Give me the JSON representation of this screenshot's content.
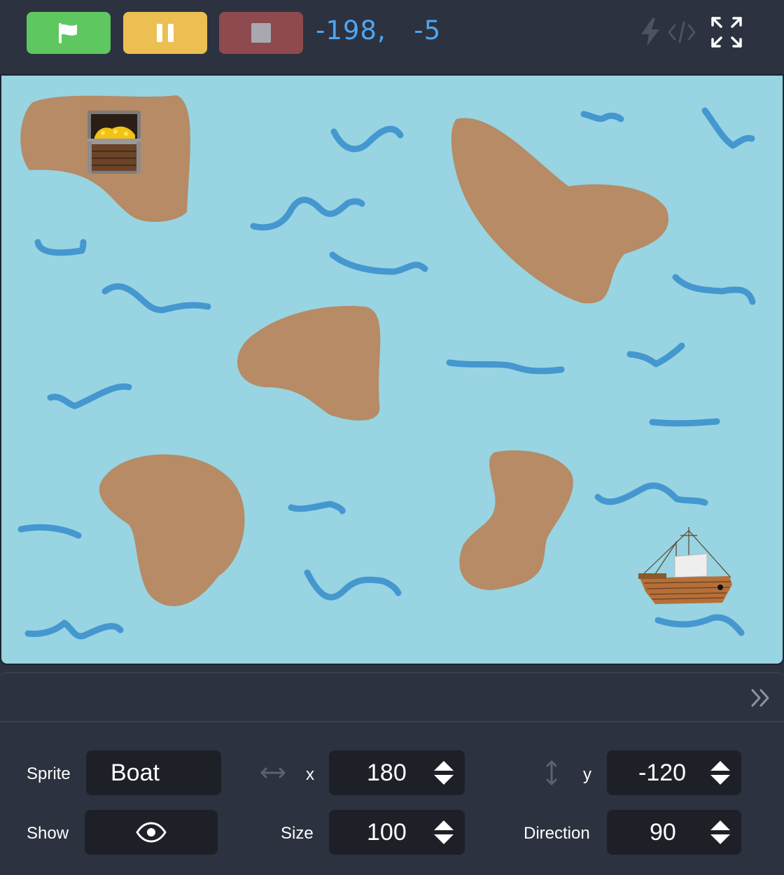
{
  "toolbar": {
    "coord_x": "-198,",
    "coord_y": "-5",
    "buttons": {
      "go": {
        "icon": "green-flag-icon",
        "color": "#5fc75f"
      },
      "pause": {
        "icon": "pause-icon",
        "color": "#ecbf52"
      },
      "stop": {
        "icon": "stop-icon",
        "color": "#8e4a4e"
      }
    },
    "coord_color": "#4ea6f0"
  },
  "stage": {
    "background": "#98d4e2",
    "island_color": "#b68b65",
    "wave_color": "#4597cf",
    "sprites": [
      "treasure-chest",
      "boat"
    ]
  },
  "sprite_panel": {
    "sprite_label": "Sprite",
    "sprite_name": "Boat",
    "x_label": "x",
    "x_value": "180",
    "y_label": "y",
    "y_value": "-120",
    "show_label": "Show",
    "size_label": "Size",
    "size_value": "100",
    "direction_label": "Direction",
    "direction_value": "90"
  }
}
